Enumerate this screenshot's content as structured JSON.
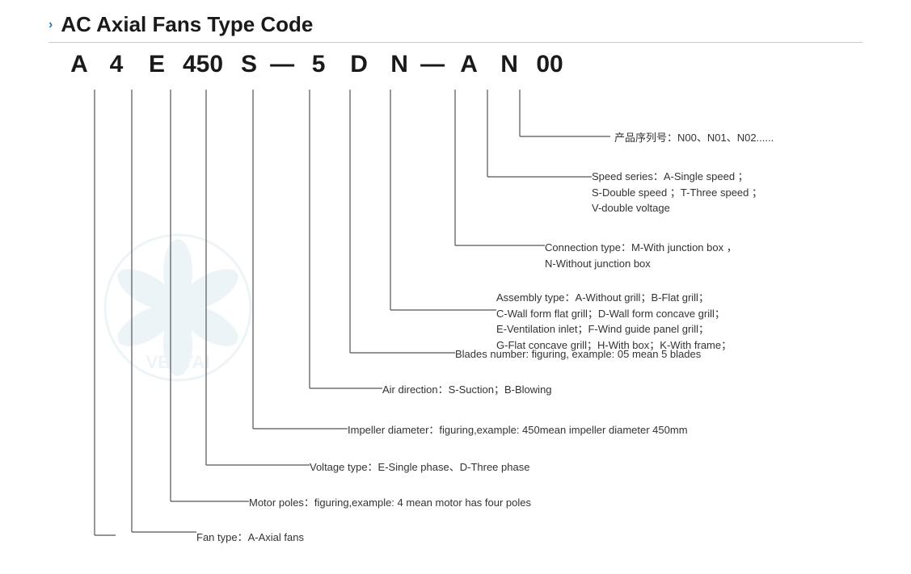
{
  "header": {
    "chevron": "›",
    "title": "AC Axial Fans Type Code",
    "divider": true
  },
  "code": {
    "letters": [
      "A",
      "4",
      "E",
      "450",
      "S",
      "—",
      "5",
      "D",
      "N",
      "—",
      "A",
      "N",
      "00"
    ]
  },
  "labels": {
    "product_cn": "产品序列号：N00、N01、N02......",
    "speed": "Speed series：A-Single speed ；\nS-Double speed ；T-Three speed ；\nV-double voltage",
    "connection": "Connection type：M-With junction box ，\nN-Without junction box",
    "assembly": "Assembly type：A-Without grill；B-Flat grill；\nC-Wall form flat grill；D-Wall form concave grill；\nE-Ventilation inlet；F-Wind guide panel grill；\nG-Flat concave grill；H-With box；K-With frame；",
    "blades": "Blades number: figuring, example: 05 mean 5 blades",
    "air": "Air direction：S-Suction；B-Blowing",
    "impeller": "Impeller diameter：figuring,example: 450mean impeller diameter 450mm",
    "voltage": "Voltage type：E-Single phase、D-Three phase",
    "motor": "Motor poles：figuring,example: 4 mean motor has four poles",
    "fan": "Fan type：A-Axial fans"
  }
}
